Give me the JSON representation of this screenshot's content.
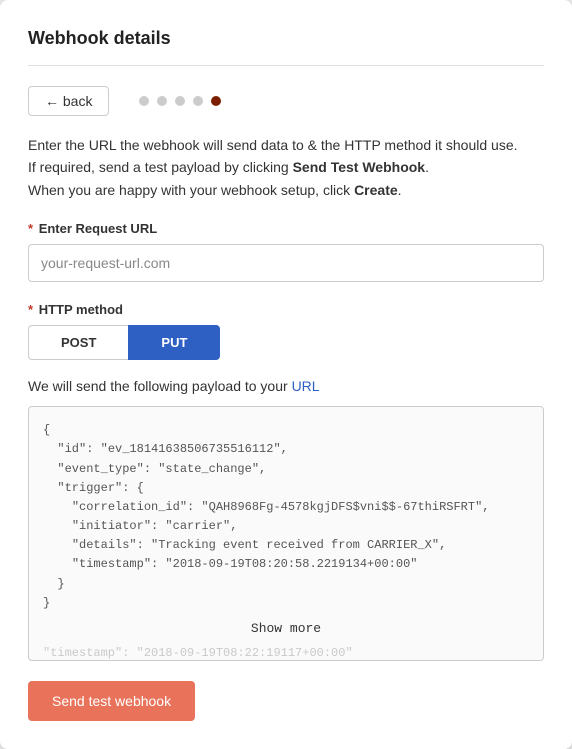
{
  "card": {
    "title": "Webhook details",
    "divider": true
  },
  "nav": {
    "back_label": "← back",
    "dots": [
      {
        "active": false
      },
      {
        "active": false
      },
      {
        "active": false
      },
      {
        "active": false
      },
      {
        "active": true
      }
    ]
  },
  "description": {
    "line1": "Enter the URL the webhook will send data to & the HTTP method it should use.",
    "line2_prefix": "If required, send a test payload by clicking ",
    "line2_link": "Send Test Webhook",
    "line2_suffix": ".",
    "line3_prefix": "When you are happy with your webhook setup, click ",
    "line3_link": "Create",
    "line3_suffix": "."
  },
  "url_field": {
    "label": "Enter Request URL",
    "placeholder": "your-request-url.com",
    "value": "your-request-url.com",
    "required": true
  },
  "http_method": {
    "label": "HTTP method",
    "required": true,
    "options": [
      {
        "label": "POST",
        "active": false
      },
      {
        "label": "PUT",
        "active": true
      }
    ]
  },
  "payload": {
    "label_prefix": "We will send the following payload to your ",
    "label_link": "URL",
    "code": "{\n  \"id\": \"ev_18141638506735516112\",\n  \"event_type\": \"state_change\",\n  \"trigger\": {\n    \"correlation_id\": \"QAH8968Fg-4578kgjDFS$vni$$-67thiRSFRT\",\n    \"initiator\": \"carrier\",\n    \"details\": \"Tracking event received from CARRIER_X\",\n    \"timestamp\": \"2018-09-19T08:20:58.2219134+00:00\"\n  }",
    "show_more": "Show more",
    "overflow_line": "\"timestamp\": \"2018-09-19T08:22:19117+00:00\""
  },
  "send_button": {
    "label": "Send test webhook"
  }
}
